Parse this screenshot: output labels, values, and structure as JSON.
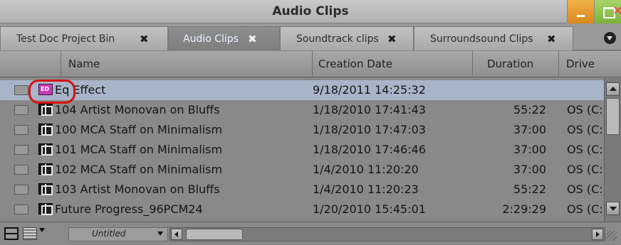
{
  "window": {
    "title": "Audio Clips",
    "colors": {
      "minimize": "#e09a2c",
      "maximize": "#8cc04a",
      "close": "#e8503d",
      "selection": "#a8b4c9",
      "highlight_ring": "#d3140f"
    }
  },
  "tabs": [
    {
      "label": "Test Doc Project Bin",
      "close": "✖",
      "active": false
    },
    {
      "label": "Audio Clips",
      "close": "✖",
      "active": true
    },
    {
      "label": "Soundtrack clips",
      "close": "✖",
      "active": false
    },
    {
      "label": "Surroundsound Clips",
      "close": "✖",
      "active": false
    }
  ],
  "columns": {
    "name": "Name",
    "date": "Creation Date",
    "duration": "Duration",
    "drive": "Drive"
  },
  "rows": [
    {
      "icon": "effect-icon",
      "name": "Eq Effect",
      "date": "9/18/2011 14:25:32",
      "duration": "",
      "drive": "",
      "selected": true
    },
    {
      "icon": "clip-icon",
      "name": "104 Artist Monovan on Bluffs",
      "date": "1/18/2010 17:41:43",
      "duration": "55:22",
      "drive": "OS (C:",
      "selected": false
    },
    {
      "icon": "clip-icon",
      "name": "100 MCA Staff on Minimalism",
      "date": "1/18/2010 17:47:03",
      "duration": "37:00",
      "drive": "OS (C:",
      "selected": false
    },
    {
      "icon": "clip-icon",
      "name": "101 MCA Staff on Minimalism",
      "date": "1/18/2010 17:46:46",
      "duration": "37:00",
      "drive": "OS (C:",
      "selected": false
    },
    {
      "icon": "clip-icon",
      "name": "102 MCA Staff on Minimalism",
      "date": "1/4/2010 11:20:20",
      "duration": "37:00",
      "drive": "OS (C:",
      "selected": false
    },
    {
      "icon": "clip-icon",
      "name": "103 Artist Monovan on Bluffs",
      "date": "1/4/2010 11:20:23",
      "duration": "55:22",
      "drive": "OS (C:",
      "selected": false
    },
    {
      "icon": "clip-icon",
      "name": "Future Progress_96PCM24",
      "date": "1/20/2010 15:45:01",
      "duration": "2:29:29",
      "drive": "OS (C:",
      "selected": false
    }
  ],
  "bottombar": {
    "view_name": "Untitled"
  }
}
